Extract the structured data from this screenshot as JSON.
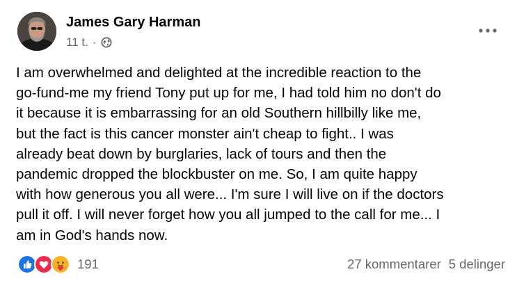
{
  "post": {
    "author": "James Gary Harman",
    "time": "11 t.",
    "separator": "·",
    "audience_icon": "globe-icon",
    "menu_icon": "more-options-icon",
    "text": "I  am overwhelmed and delighted at the incredible reaction to the\ngo-fund-me my friend Tony put up for me, I had told him no don't do\nit  because it is embarrassing for an old Southern hillbilly like me,\nbut  the fact is this cancer monster ain't cheap to fight.. I was\nalready  beat down by burglaries, lack of tours and then the\npandemic dropped the  blockbuster on me.  So, I am quite happy\nwith how generous you all  were... I'm sure I will live on if the doctors\npull it off. I will never  forget how you all jumped to the call for me... I\nam in God's hands  now."
  },
  "footer": {
    "reaction_icons": [
      "like-icon",
      "love-icon",
      "care-icon"
    ],
    "reaction_count": "191",
    "comments": "27 kommentarer",
    "shares": "5 delinger"
  },
  "colors": {
    "like": "#1b74e4",
    "love": "#f0284a",
    "care": "#f7b125",
    "secondary_text": "#65676b",
    "primary_text": "#050505"
  }
}
